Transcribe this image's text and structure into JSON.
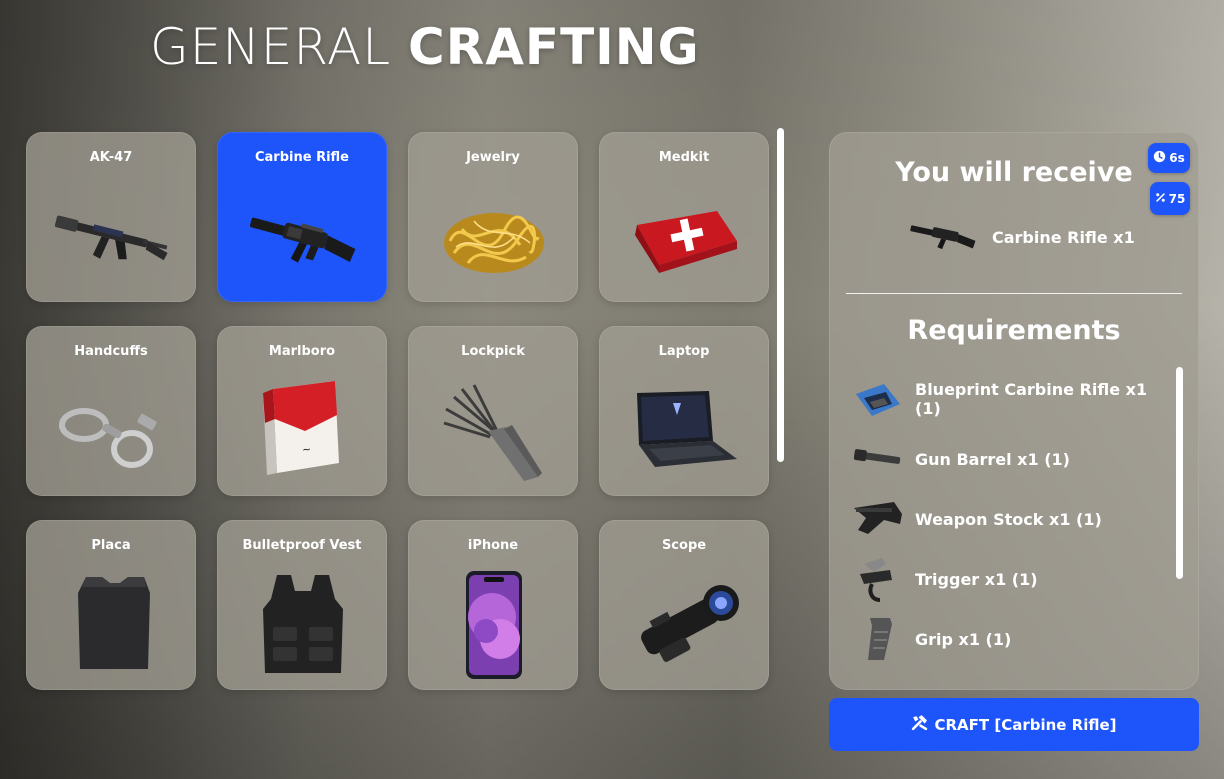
{
  "title": {
    "light": "GENERAL",
    "bold": "CRAFTING"
  },
  "items": [
    {
      "label": "AK-47",
      "icon": "ak47-icon"
    },
    {
      "label": "Carbine Rifle",
      "icon": "carbine-rifle-icon"
    },
    {
      "label": "Jewelry",
      "icon": "jewelry-icon"
    },
    {
      "label": "Medkit",
      "icon": "medkit-icon"
    },
    {
      "label": "Handcuffs",
      "icon": "handcuffs-icon"
    },
    {
      "label": "Marlboro",
      "icon": "cigarette-pack-icon"
    },
    {
      "label": "Lockpick",
      "icon": "lockpick-icon"
    },
    {
      "label": "Laptop",
      "icon": "laptop-icon"
    },
    {
      "label": "Placa",
      "icon": "armor-plate-icon"
    },
    {
      "label": "Bulletproof Vest",
      "icon": "vest-icon"
    },
    {
      "label": "iPhone",
      "icon": "phone-icon"
    },
    {
      "label": "Scope",
      "icon": "scope-icon"
    }
  ],
  "selected_item": "Carbine Rifle",
  "panel": {
    "receive_title": "You will receive",
    "time_badge": "6s",
    "xp_badge": "75",
    "receive_item": "Carbine Rifle x1",
    "requirements_title": "Requirements",
    "requirements": [
      {
        "label": "Blueprint Carbine Rifle x1 (1)",
        "icon": "blueprint-icon"
      },
      {
        "label": "Gun Barrel x1 (1)",
        "icon": "gun-barrel-icon"
      },
      {
        "label": "Weapon Stock x1 (1)",
        "icon": "weapon-stock-icon"
      },
      {
        "label": "Trigger x1 (1)",
        "icon": "trigger-icon"
      },
      {
        "label": "Grip x1 (1)",
        "icon": "grip-icon"
      }
    ]
  },
  "craft_button": "CRAFT [Carbine Rifle]",
  "colors": {
    "accent": "#1e55fb",
    "card": "#a09c92"
  }
}
